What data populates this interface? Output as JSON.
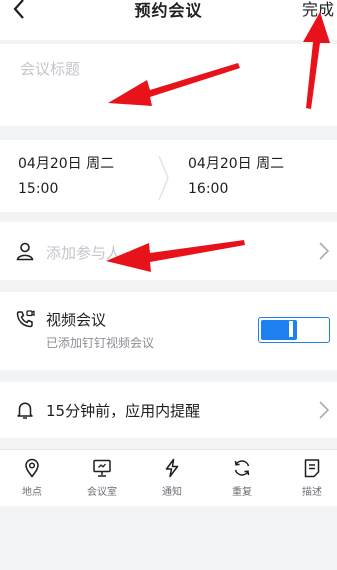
{
  "header": {
    "title": "预约会议",
    "done_label": "完成"
  },
  "title_field": {
    "placeholder": "会议标题"
  },
  "time": {
    "start_date": "04月20日 周二",
    "start_time": "15:00",
    "end_date": "04月20日 周二",
    "end_time": "16:00"
  },
  "participants": {
    "placeholder": "添加参与人"
  },
  "video": {
    "title": "视频会议",
    "subtitle": "已添加钉钉视频会议",
    "enabled": true
  },
  "reminder": {
    "text": "15分钟前，应用内提醒"
  },
  "toolbar": {
    "location": "地点",
    "meeting_room": "会议室",
    "notify": "通知",
    "repeat": "重复",
    "description": "描述"
  },
  "colors": {
    "accent": "#1e7ff0",
    "annotation": "#e8131a"
  }
}
